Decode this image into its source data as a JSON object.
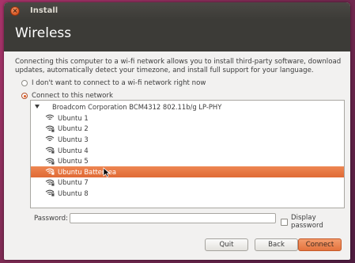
{
  "window": {
    "title": "Install",
    "close_glyph": "×"
  },
  "header": {
    "page_title": "Wireless"
  },
  "main": {
    "description": "Connecting this computer to a wi-fi network allows you to install third-party software, download updates, automatically detect your timezone, and install full support for your language.",
    "option_no_wifi": "I don't want to connect to a wi-fi network right now",
    "option_connect": "Connect to this network",
    "selected_option": "Connect to this network"
  },
  "network_list": {
    "adapter": "Broadcom Corporation BCM4312 802.11b/g LP-PHY",
    "networks": [
      {
        "name": "Ubuntu 1",
        "secured": false,
        "selected": false
      },
      {
        "name": "Ubuntu 2",
        "secured": true,
        "selected": false
      },
      {
        "name": "Ubuntu 3",
        "secured": false,
        "selected": false
      },
      {
        "name": "Ubuntu 4",
        "secured": true,
        "selected": false
      },
      {
        "name": "Ubuntu 5",
        "secured": true,
        "selected": false
      },
      {
        "name": "Ubuntu Battersea",
        "secured": true,
        "selected": true
      },
      {
        "name": "Ubuntu 7",
        "secured": true,
        "selected": false
      },
      {
        "name": "Ubuntu 8",
        "secured": true,
        "selected": false
      }
    ]
  },
  "password": {
    "label": "Password:",
    "value": "",
    "display_label": "Display password",
    "display_checked": false
  },
  "buttons": {
    "quit": "Quit",
    "back": "Back",
    "connect": "Connect"
  },
  "colors": {
    "accent": "#e06a35",
    "header_bg": "#3c3b37",
    "window_bg": "#f2f1f0"
  }
}
